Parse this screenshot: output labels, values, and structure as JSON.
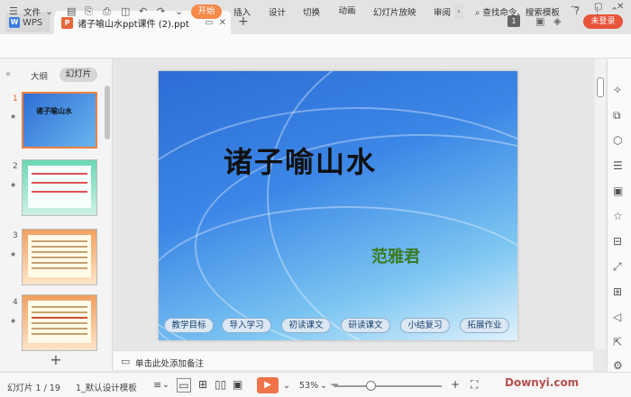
{
  "titlebar": {
    "app_tab": "WPS",
    "doc_tab": "诸子喻山水ppt课件 (2).ppt",
    "new_tab": "+",
    "badge": "1",
    "login": "未登录"
  },
  "menubar": {
    "file": "文件",
    "start": "开始",
    "insert": "插入",
    "design": "设计",
    "switch": "切换",
    "animation": "动画",
    "slideshow": "幻灯片放映",
    "review": "审阅",
    "search": "查找命令、搜索模板"
  },
  "leftpanel": {
    "tab_outline": "大纲",
    "tab_slides": "幻灯片",
    "thumbnails": [
      {
        "num": "1",
        "title": "诸子喻山水"
      },
      {
        "num": "2"
      },
      {
        "num": "3"
      },
      {
        "num": "4"
      }
    ],
    "add": "+"
  },
  "slide": {
    "title": "诸子喻山水",
    "author": "范雅君",
    "buttons": [
      "教学目标",
      "导入学习",
      "初读课文",
      "研读课文",
      "小结复习",
      "拓展作业"
    ]
  },
  "notes": {
    "placeholder": "单击此处添加备注"
  },
  "statusbar": {
    "slide_count": "幻灯片 1 / 19",
    "theme": "1_默认设计模板",
    "zoom": "53%",
    "watermark": "Downyi.com"
  },
  "colors": {
    "accent_orange": "#f58a4a",
    "login_red": "#e8533a",
    "play_orange": "#f0744a"
  }
}
